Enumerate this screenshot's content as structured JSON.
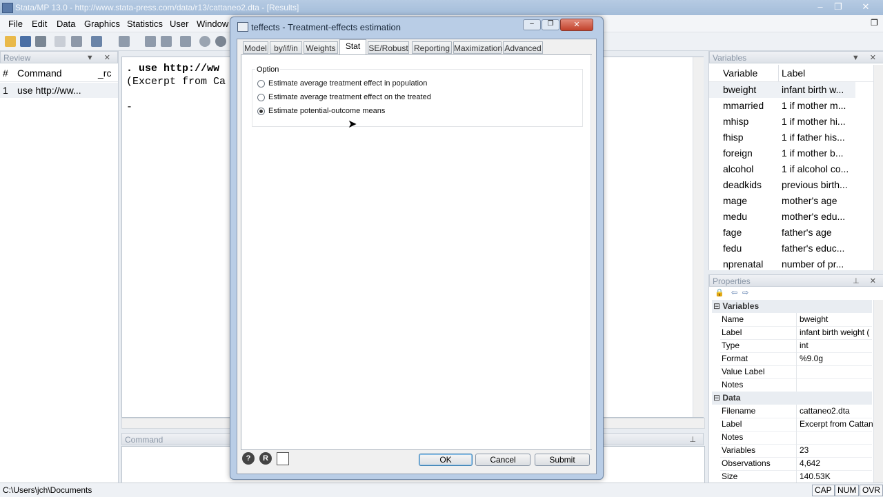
{
  "window": {
    "title": "Stata/MP 13.0 - http://www.stata-press.com/data/r13/cattaneo2.dta - [Results]",
    "controls": [
      "–",
      "❐",
      "✕"
    ],
    "restore_glyph": "❐"
  },
  "menubar": [
    "File",
    "Edit",
    "Data",
    "Graphics",
    "Statistics",
    "User",
    "Window"
  ],
  "review": {
    "title": "Review",
    "columns": {
      "num": "#",
      "command": "Command",
      "rc": "_rc"
    },
    "rows": [
      {
        "num": "1",
        "command": "use http://ww..."
      }
    ]
  },
  "results": {
    "lines": [
      ". use http://ww",
      "(Excerpt from Ca",
      "-"
    ]
  },
  "command_window": {
    "title": "Command"
  },
  "variables": {
    "title": "Variables",
    "columns": {
      "variable": "Variable",
      "label": "Label"
    },
    "rows": [
      {
        "name": "bweight",
        "label": "infant birth w..."
      },
      {
        "name": "mmarried",
        "label": "1 if mother m..."
      },
      {
        "name": "mhisp",
        "label": "1 if mother hi..."
      },
      {
        "name": "fhisp",
        "label": "1 if father his..."
      },
      {
        "name": "foreign",
        "label": "1 if mother b..."
      },
      {
        "name": "alcohol",
        "label": "1 if alcohol co..."
      },
      {
        "name": "deadkids",
        "label": "previous birth..."
      },
      {
        "name": "mage",
        "label": "mother's age"
      },
      {
        "name": "medu",
        "label": "mother's edu..."
      },
      {
        "name": "fage",
        "label": "father's age"
      },
      {
        "name": "fedu",
        "label": "father's educ..."
      },
      {
        "name": "nprenatal",
        "label": "number of pr..."
      }
    ]
  },
  "properties": {
    "title": "Properties",
    "variables_section": "Variables",
    "variables": [
      {
        "name": "Name",
        "value": "bweight"
      },
      {
        "name": "Label",
        "value": "infant birth weight ("
      },
      {
        "name": "Type",
        "value": "int"
      },
      {
        "name": "Format",
        "value": "%9.0g"
      },
      {
        "name": "Value Label",
        "value": ""
      },
      {
        "name": "Notes",
        "value": ""
      }
    ],
    "data_section": "Data",
    "data": [
      {
        "name": "Filename",
        "value": "cattaneo2.dta"
      },
      {
        "name": "Label",
        "value": "Excerpt from Cattan"
      },
      {
        "name": "Notes",
        "value": ""
      },
      {
        "name": "Variables",
        "value": "23"
      },
      {
        "name": "Observations",
        "value": "4,642"
      },
      {
        "name": "Size",
        "value": "140.53K"
      }
    ]
  },
  "status": {
    "path": "C:\\Users\\jch\\Documents",
    "indicators": [
      "CAP",
      "NUM",
      "OVR"
    ]
  },
  "dialog": {
    "title": "teffects - Treatment-effects estimation",
    "tabs": [
      "Model",
      "by/if/in",
      "Weights",
      "Stat",
      "SE/Robust",
      "Reporting",
      "Maximization",
      "Advanced"
    ],
    "active_tab": "Stat",
    "group_label": "Option",
    "options": [
      {
        "label": "Estimate average treatment effect in population",
        "selected": false
      },
      {
        "label": "Estimate average treatment effect on the treated",
        "selected": false
      },
      {
        "label": "Estimate potential-outcome means",
        "selected": true
      }
    ],
    "buttons": {
      "ok": "OK",
      "cancel": "Cancel",
      "submit": "Submit"
    },
    "help_icons": [
      "?",
      "R"
    ]
  },
  "colors": {
    "accent": "#3c7fb1",
    "title_bar": "#a3bcd9",
    "dialog_frame": "#b9cde6"
  }
}
